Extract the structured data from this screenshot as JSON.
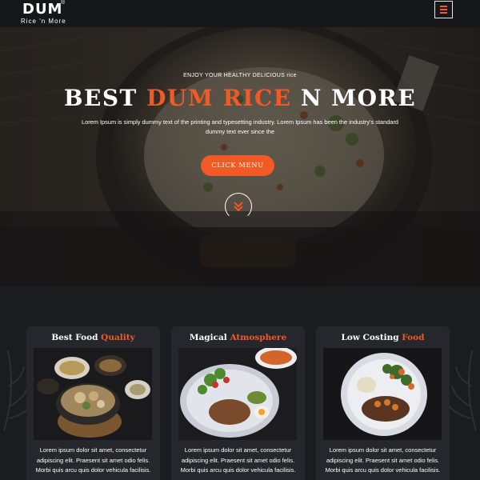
{
  "header": {
    "logo_main": "DUM",
    "logo_reg": "®",
    "logo_sub": "Rice 'n More",
    "menu_icon": "hamburger-icon"
  },
  "hero": {
    "kicker": "ENJOY YOUR HEALTHY DELICIOUS rice",
    "title_pre": "BEST ",
    "title_accent": "DUM RICE",
    "title_post": " N MORE",
    "text": "Lorem Ipsum is simply dummy text of the printing and typesetting industry. Lorem Ipsum has been the industry's standard dummy text ever since the",
    "cta_label": "CLICK MENU",
    "scroll_icon": "double-chevron-down-icon"
  },
  "features": [
    {
      "title_pre": "Best Food ",
      "title_accent": "Quality",
      "text": "Lorem ipsum dolor sit amet, consectetur adipiscing elit. Praesent sit amet odio felis. Morbi quis arcu quis dolor vehicula facilisis."
    },
    {
      "title_pre": "Magical ",
      "title_accent": "Atmosphere",
      "text": "Lorem ipsum dolor sit amet, consectetur adipiscing elit. Praesent sit amet odio felis. Morbi quis arcu quis dolor vehicula facilisis."
    },
    {
      "title_pre": "Low Costing ",
      "title_accent": "Food",
      "text": "Lorem ipsum dolor sit amet, consectetur adipiscing elit. Praesent sit amet odio felis. Morbi quis arcu quis dolor vehicula facilisis."
    }
  ],
  "colors": {
    "accent": "#f15a24",
    "background": "#1b1c20",
    "card": "#26272c",
    "header": "#16171b"
  }
}
